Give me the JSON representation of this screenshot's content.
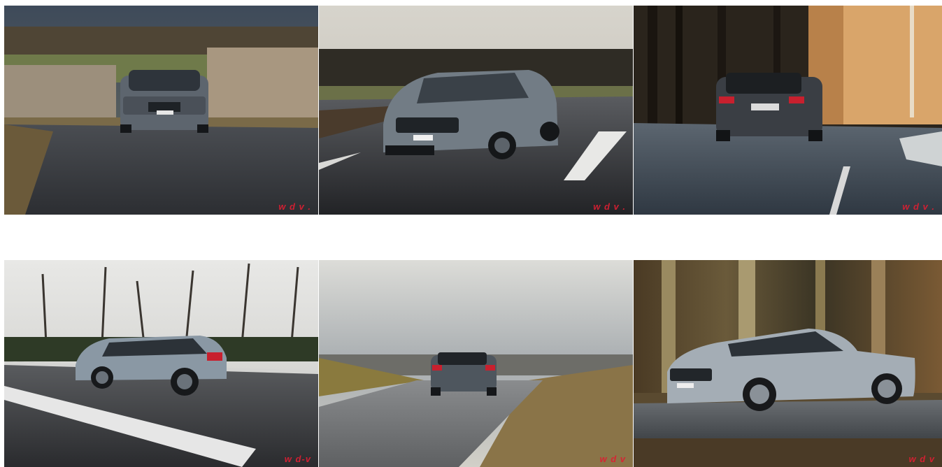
{
  "gallery": {
    "photos": [
      {
        "watermark": "w  d  v ."
      },
      {
        "watermark": "w  d  v ."
      },
      {
        "watermark": "w  d  v ."
      },
      {
        "watermark": "w     d-v"
      },
      {
        "watermark": "w  d  v"
      },
      {
        "watermark": "w  d  v"
      }
    ]
  },
  "colors": {
    "watermark": "#dc1e32",
    "car_gray": "#7d8790",
    "asphalt": "#3a3d42",
    "background": "#ffffff"
  }
}
